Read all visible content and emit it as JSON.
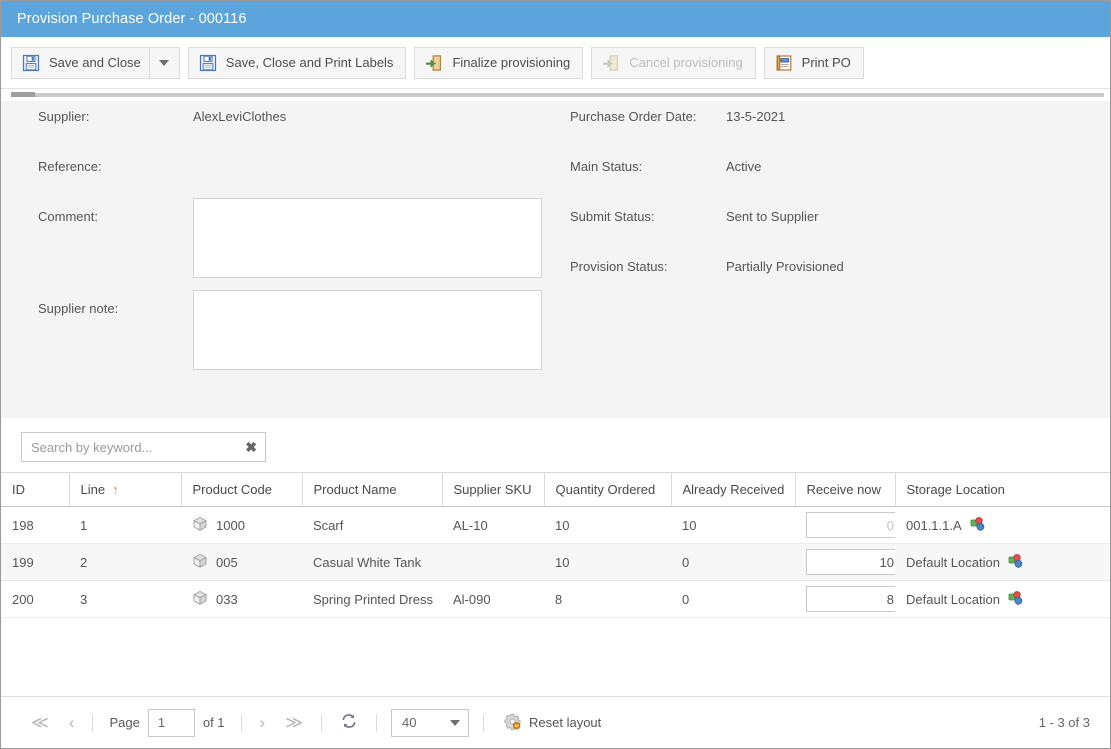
{
  "window": {
    "title": "Provision Purchase Order - 000116",
    "title_bar_color": "#5ba4dc"
  },
  "toolbar": {
    "buttons": [
      {
        "label": "Save and Close",
        "icon": "save-floppy-icon",
        "disabled": false,
        "has_dropdown": true
      },
      {
        "label": "Save, Close and Print Labels",
        "icon": "save-floppy-icon",
        "disabled": false,
        "has_dropdown": false
      },
      {
        "label": "Finalize provisioning",
        "icon": "door-exit-green-arrow-icon",
        "disabled": false,
        "has_dropdown": false
      },
      {
        "label": "Cancel provisioning",
        "icon": "door-exit-green-arrow-icon",
        "disabled": true,
        "has_dropdown": false
      },
      {
        "label": "Print PO",
        "icon": "report-notepad-icon",
        "disabled": false,
        "has_dropdown": false
      }
    ]
  },
  "form": {
    "left": [
      {
        "label": "Supplier:",
        "value": "AlexLeviClothes",
        "type": "text"
      },
      {
        "label": "Reference:",
        "value": "",
        "type": "text"
      },
      {
        "label": "Comment:",
        "value": "",
        "type": "textarea"
      },
      {
        "label": "Supplier note:",
        "value": "",
        "type": "textarea"
      }
    ],
    "right": [
      {
        "label": "Purchase Order Date:",
        "value": "13-5-2021"
      },
      {
        "label": "Main Status:",
        "value": "Active"
      },
      {
        "label": "Submit Status:",
        "value": "Sent to Supplier"
      },
      {
        "label": "Provision Status:",
        "value": "Partially Provisioned"
      }
    ]
  },
  "search": {
    "placeholder": "Search by keyword...",
    "value": "",
    "clear_icon": "clear-x-icon"
  },
  "grid": {
    "columns": [
      {
        "key": "id",
        "label": "ID",
        "sort": ""
      },
      {
        "key": "line",
        "label": "Line",
        "sort": "asc"
      },
      {
        "key": "product_code",
        "label": "Product Code",
        "sort": ""
      },
      {
        "key": "product_name",
        "label": "Product Name",
        "sort": ""
      },
      {
        "key": "supplier_sku",
        "label": "Supplier SKU",
        "sort": ""
      },
      {
        "key": "quantity_ordered",
        "label": "Quantity Ordered",
        "sort": ""
      },
      {
        "key": "already_received",
        "label": "Already Received",
        "sort": ""
      },
      {
        "key": "receive_now",
        "label": "Receive now",
        "sort": ""
      },
      {
        "key": "storage_location",
        "label": "Storage Location",
        "sort": ""
      }
    ],
    "sort_asc_glyph": "↑",
    "rows": [
      {
        "id": "198",
        "line": "1",
        "product_code": "1000",
        "product_name": "Scarf",
        "supplier_sku": "AL-10",
        "quantity_ordered": "10",
        "already_received": "10",
        "receive_now": "0",
        "receive_now_muted": true,
        "storage_location": "001.1.1.A"
      },
      {
        "id": "199",
        "line": "2",
        "product_code": "005",
        "product_name": "Casual White Tank",
        "supplier_sku": "",
        "quantity_ordered": "10",
        "already_received": "0",
        "receive_now": "10",
        "receive_now_muted": false,
        "storage_location": "Default Location"
      },
      {
        "id": "200",
        "line": "3",
        "product_code": "033",
        "product_name": "Spring Printed Dress",
        "supplier_sku": "Al-090",
        "quantity_ordered": "8",
        "already_received": "0",
        "receive_now": "8",
        "receive_now_muted": false,
        "storage_location": "Default Location"
      }
    ]
  },
  "pager": {
    "first_glyph": "≪",
    "prev_glyph": "‹",
    "next_glyph": "›",
    "last_glyph": "≫",
    "page_label": "Page",
    "page_value": "1",
    "of_label": "of 1",
    "refresh_icon": "refresh-icon",
    "page_size": "40",
    "reset_layout_label": "Reset layout",
    "reset_layout_icon": "gear-icon",
    "record_count": "1 - 3 of 3"
  }
}
